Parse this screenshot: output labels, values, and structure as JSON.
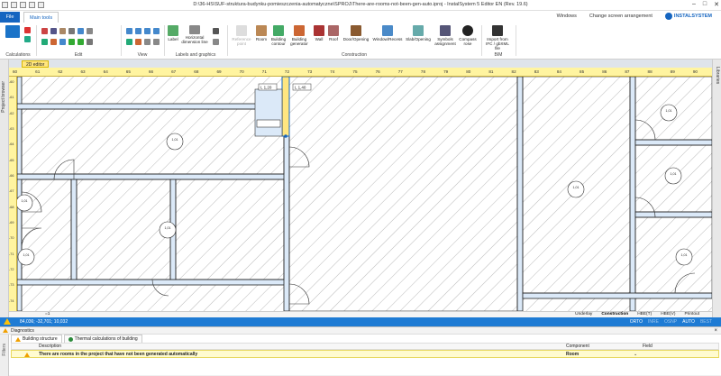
{
  "window": {
    "title": "D:\\36-HS\\SUF-struktura-budynku-pomieszczenia-automatyczne\\SPROJ\\There-are-rooms-not-been-gen-auto.iproj - InstalSystem 5 Editor EN (Rev. 19.6)"
  },
  "tabs": {
    "file": "File",
    "main": "Main tools"
  },
  "top_right": {
    "windows": "Windows",
    "arrangement": "Change screen arrangement",
    "brand": "INSTALSYSTEM"
  },
  "ribbon": {
    "groups": {
      "calculations": "Calculations",
      "edit": "Edit",
      "view": "View",
      "labels": "Labels and graphics",
      "construction": "Construction",
      "bim": "BIM"
    },
    "buttons": {
      "label": "Label",
      "horizontal_dimension": "Horizontal dimension line",
      "reference_point": "Reference point",
      "room": "Room",
      "building_contour": "Building contour",
      "building_generator": "Building generator",
      "wall": "Wall",
      "roof": "Roof",
      "door_opening": "Door/Opening",
      "window_recess": "Window/Recess",
      "slab_opening": "Slab/Opening",
      "symbols_assignment": "Symbols assignment",
      "compass_rose": "Compass rose",
      "import_ifc": "Import from IFC / gbXML file"
    }
  },
  "editor_tab": "2D editor",
  "side_panels": {
    "left": "Project browser",
    "right": "Libraries"
  },
  "ruler": {
    "top": [
      "60",
      "61",
      "62",
      "63",
      "64",
      "65",
      "66",
      "67",
      "68",
      "69",
      "70",
      "71",
      "72",
      "73",
      "74",
      "75",
      "76",
      "77",
      "78",
      "79",
      "80",
      "81",
      "82",
      "83",
      "84",
      "85",
      "86",
      "87",
      "88",
      "89",
      "90"
    ],
    "left": [
      "-60",
      "-61",
      "-62",
      "-63",
      "-64",
      "-65",
      "-66",
      "-67",
      "-68",
      "-69",
      "-70",
      "-71",
      "-72",
      "-73",
      "-74"
    ]
  },
  "canvas": {
    "labels": {
      "level_a": "L 1,20",
      "level_b": "L 1,40",
      "room_tag": "1,01"
    }
  },
  "viewbar": {
    "zoom": "=1",
    "modes": [
      "Underlay",
      "Construction",
      "HBE(T)",
      "HBE(V)",
      "Printout"
    ],
    "active_mode": "Construction"
  },
  "status": {
    "coords": "84,036; -32,701; 10,032",
    "flags": [
      "ORTO",
      "INRE",
      "OSNP",
      "AUTO",
      "BEST"
    ],
    "active_flags": [
      "ORTO",
      "AUTO"
    ]
  },
  "diagnostics": {
    "title": "Diagnostics",
    "side": "Filters",
    "tabs": [
      "Building structure",
      "Thermal calculations of building"
    ],
    "columns": {
      "description": "Description",
      "component": "Component",
      "field": "Field"
    },
    "rows": [
      {
        "description": "There are rooms in the project that have not been generated automatically",
        "component": "Room"
      }
    ]
  }
}
